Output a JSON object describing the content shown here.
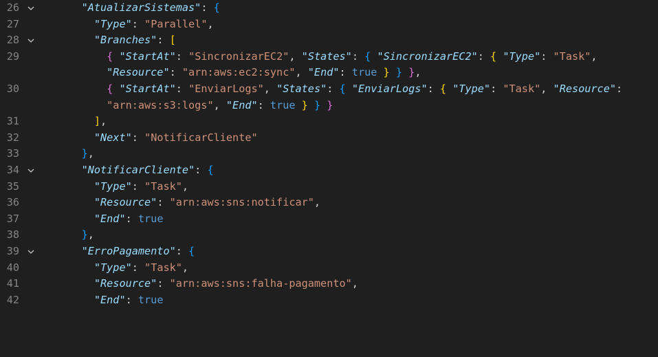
{
  "editor": {
    "lines": [
      {
        "num": "26",
        "fold": true
      },
      {
        "num": "27",
        "fold": false
      },
      {
        "num": "28",
        "fold": true
      },
      {
        "num": "29",
        "fold": false
      },
      {
        "num": "",
        "fold": false
      },
      {
        "num": "30",
        "fold": false
      },
      {
        "num": "",
        "fold": false
      },
      {
        "num": "31",
        "fold": false
      },
      {
        "num": "32",
        "fold": false
      },
      {
        "num": "33",
        "fold": false
      },
      {
        "num": "34",
        "fold": true
      },
      {
        "num": "35",
        "fold": false
      },
      {
        "num": "36",
        "fold": false
      },
      {
        "num": "37",
        "fold": false
      },
      {
        "num": "38",
        "fold": false
      },
      {
        "num": "39",
        "fold": true
      },
      {
        "num": "40",
        "fold": false
      },
      {
        "num": "41",
        "fold": false
      },
      {
        "num": "42",
        "fold": false
      }
    ],
    "code": {
      "l26": {
        "key": "\"AtualizarSistemas\""
      },
      "l27": {
        "key": "\"Type\"",
        "val": "\"Parallel\""
      },
      "l28": {
        "key": "\"Branches\""
      },
      "l29": {
        "k1": "\"StartAt\"",
        "v1": "\"SincronizarEC2\"",
        "k2": "\"States\"",
        "k3": "\"SincronizarEC2\"",
        "k4": "\"Type\"",
        "v4": "\"Task\""
      },
      "l29b": {
        "k5": "\"Resource\"",
        "v5": "\"arn:aws:ec2:sync\"",
        "k6": "\"End\"",
        "v6": "true"
      },
      "l30": {
        "k1": "\"StartAt\"",
        "v1": "\"EnviarLogs\"",
        "k2": "\"States\"",
        "k3": "\"EnviarLogs\"",
        "k4": "\"Type\"",
        "v4": "\"Task\"",
        "k5": "\"Resource\""
      },
      "l30b": {
        "v5": "\"arn:aws:s3:logs\"",
        "k6": "\"End\"",
        "v6": "true"
      },
      "l32": {
        "key": "\"Next\"",
        "val": "\"NotificarCliente\""
      },
      "l34": {
        "key": "\"NotificarCliente\""
      },
      "l35": {
        "key": "\"Type\"",
        "val": "\"Task\""
      },
      "l36": {
        "key": "\"Resource\"",
        "val": "\"arn:aws:sns:notificar\""
      },
      "l37": {
        "key": "\"End\"",
        "val": "true"
      },
      "l39": {
        "key": "\"ErroPagamento\""
      },
      "l40": {
        "key": "\"Type\"",
        "val": "\"Task\""
      },
      "l41": {
        "key": "\"Resource\"",
        "val": "\"arn:aws:sns:falha-pagamento\""
      },
      "l42": {
        "key": "\"End\"",
        "val": "true"
      }
    }
  },
  "colors": {
    "background": "#1f1f1f",
    "key": "#9cdcfe",
    "string": "#ce9178",
    "boolean": "#4ec9b0",
    "bracket_gold": "#ffd700",
    "bracket_purple": "#da70d6",
    "bracket_blue": "#179fff",
    "line_number": "#858585"
  },
  "icons": {
    "fold": "chevron-down-icon"
  }
}
